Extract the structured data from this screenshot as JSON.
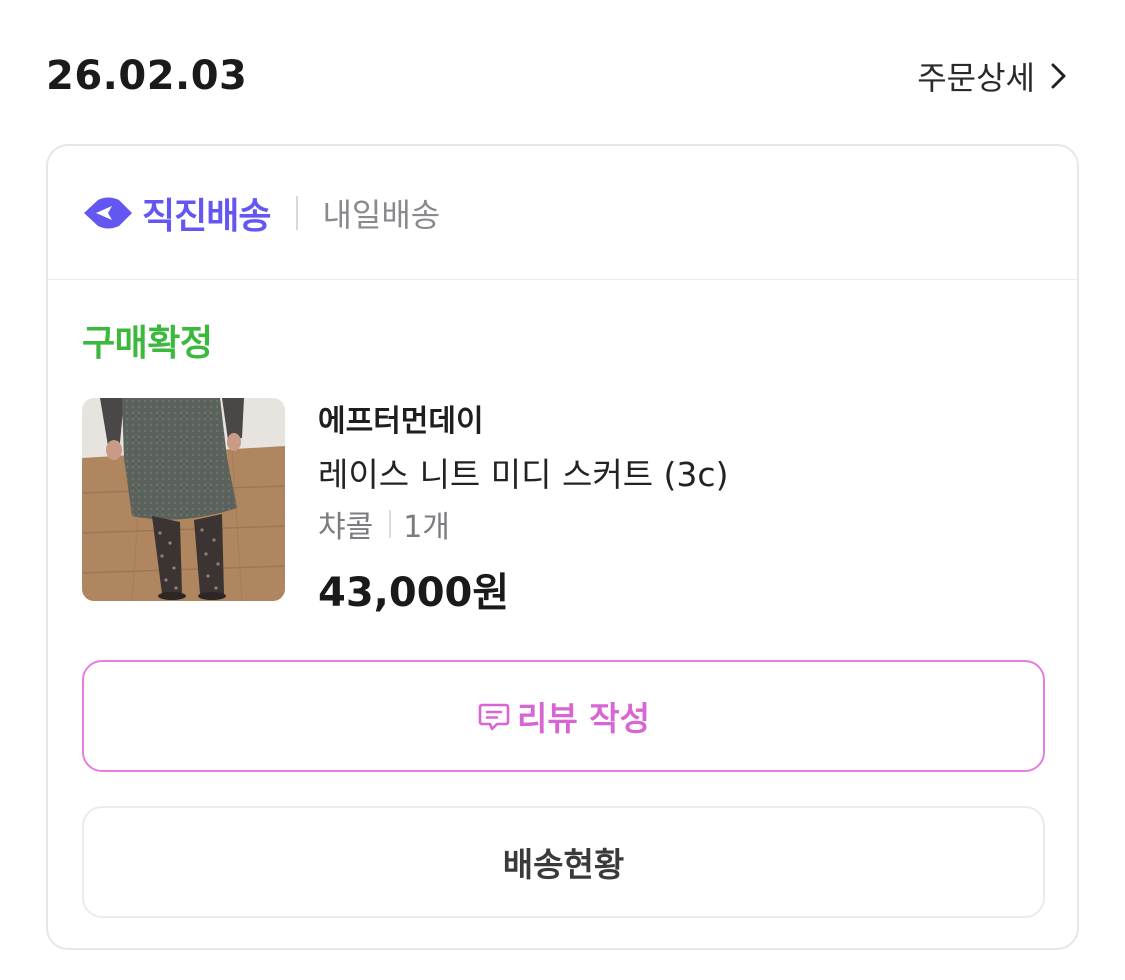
{
  "order": {
    "date": "26.02.03",
    "detail_label": "주문상세"
  },
  "shipping": {
    "brand_label": "직진배송",
    "sub_label": "내일배송",
    "brand_color": "#6457f1"
  },
  "status": {
    "label": "구매확정",
    "color": "#3cb83c"
  },
  "product": {
    "seller": "에프터먼데이",
    "name": "레이스 니트 미디 스커트 (3c)",
    "color_option": "챠콜",
    "quantity": "1개",
    "price": "43,000원",
    "thumbnail_alt": "Model wearing charcoal knit midi skirt"
  },
  "actions": {
    "review_label": "리뷰 작성",
    "review_icon": "chat-bubble-icon",
    "review_color": "#d766d4",
    "track_label": "배송현황"
  }
}
